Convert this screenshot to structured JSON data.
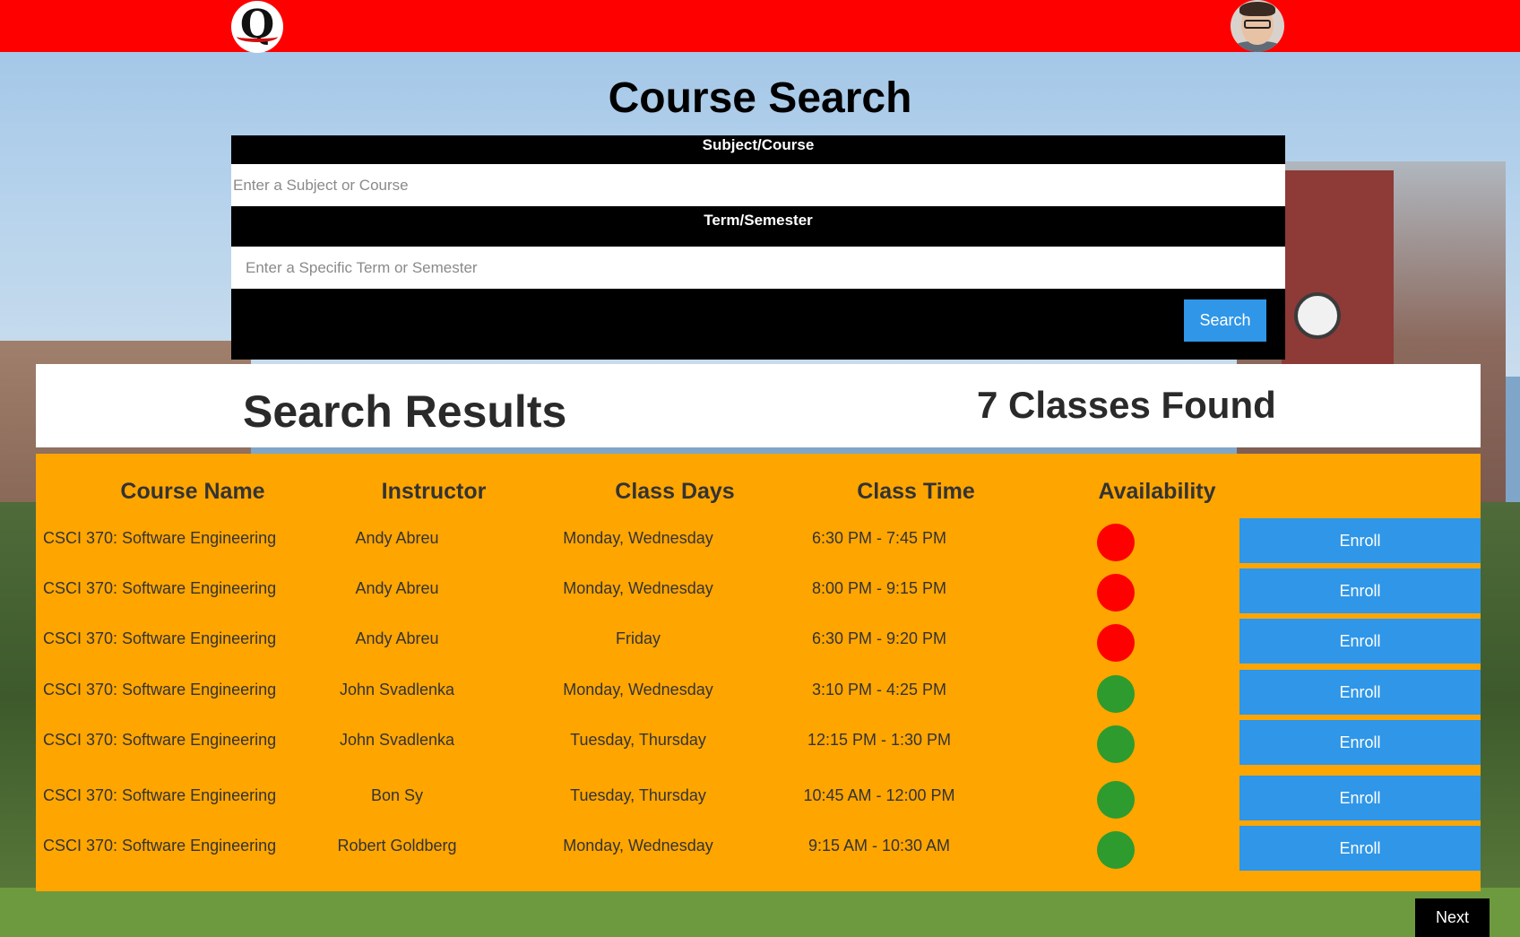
{
  "page": {
    "title": "Course Search"
  },
  "colors": {
    "header_bar": "#ff0000",
    "accent_button": "#2f96e8",
    "results_panel": "#ffa500",
    "status_full": "#ff0000",
    "status_open": "#2e9b2e"
  },
  "search": {
    "subject_label": "Subject/Course",
    "subject_placeholder": "Enter a Subject or Course",
    "subject_value": "",
    "term_label": "Term/Semester",
    "term_placeholder": "Enter a Specific Term or Semester",
    "term_value": "",
    "button_label": "Search"
  },
  "results": {
    "title": "Search Results",
    "count_label": "7 Classes Found",
    "columns": [
      "Course Name",
      "Instructor",
      "Class Days",
      "Class Time",
      "Availability"
    ],
    "rows": [
      {
        "course": "CSCI 370: Software Engineering",
        "instructor": "Andy Abreu",
        "days": "Monday, Wednesday",
        "time": "6:30 PM - 7:45 PM",
        "availability": "full",
        "action": "Enroll"
      },
      {
        "course": "CSCI 370: Software Engineering",
        "instructor": "Andy Abreu",
        "days": "Monday, Wednesday",
        "time": "8:00 PM - 9:15 PM",
        "availability": "full",
        "action": "Enroll"
      },
      {
        "course": "CSCI 370: Software Engineering",
        "instructor": "Andy Abreu",
        "days": "Friday",
        "time": "6:30 PM - 9:20 PM",
        "availability": "full",
        "action": "Enroll"
      },
      {
        "course": "CSCI 370: Software Engineering",
        "instructor": "John Svadlenka",
        "days": "Monday, Wednesday",
        "time": "3:10 PM - 4:25 PM",
        "availability": "open",
        "action": "Enroll"
      },
      {
        "course": "CSCI 370: Software Engineering",
        "instructor": "John Svadlenka",
        "days": "Tuesday, Thursday",
        "time": "12:15 PM - 1:30 PM",
        "availability": "open",
        "action": "Enroll"
      },
      {
        "course": "CSCI 370: Software Engineering",
        "instructor": "Bon Sy",
        "days": "Tuesday, Thursday",
        "time": "10:45 AM - 12:00 PM",
        "availability": "open",
        "action": "Enroll"
      },
      {
        "course": "CSCI 370: Software Engineering",
        "instructor": "Robert Goldberg",
        "days": "Monday, Wednesday",
        "time": "9:15 AM - 10:30 AM",
        "availability": "open",
        "action": "Enroll"
      }
    ]
  },
  "footer": {
    "next_label": "Next"
  },
  "icons": {
    "logo": "q-logo-icon",
    "profile": "user-avatar"
  }
}
